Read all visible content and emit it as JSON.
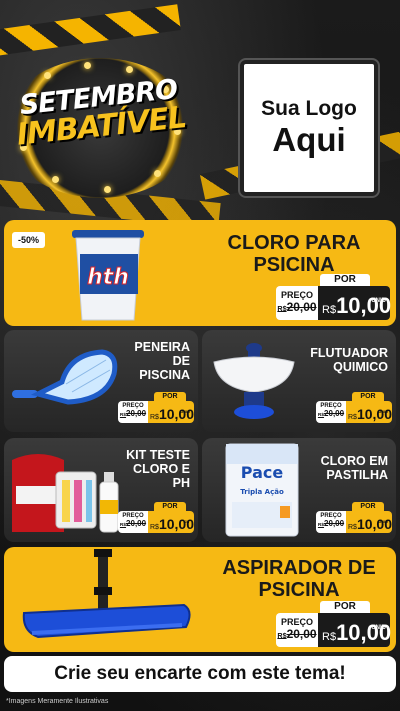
{
  "hero": {
    "badge_line1": "SETEMBRO",
    "badge_line2": "IMBATÍVEL",
    "logo_line1": "Sua Logo",
    "logo_line2": "Aqui"
  },
  "products": [
    {
      "name_line1": "CLORO PARA",
      "name_line2": "PSICINA",
      "discount": "-50%",
      "price_label": "PREÇO",
      "old_currency": "R$",
      "old_price": "20,00",
      "por": "POR",
      "currency": "R$",
      "price": "10,00",
      "unit": "UNID",
      "image_brand": "hth"
    },
    {
      "name_line1": "PENEIRA",
      "name_line2": "DE",
      "name_line3": "PISCINA",
      "price_label": "PREÇO",
      "old_currency": "R$",
      "old_price": "20,00",
      "por": "POR",
      "currency": "R$",
      "price": "10,00",
      "unit": "UNID"
    },
    {
      "name_line1": "FLUTUADOR",
      "name_line2": "QUIMICO",
      "price_label": "PREÇO",
      "old_currency": "R$",
      "old_price": "20,00",
      "por": "POR",
      "currency": "R$",
      "price": "10,00",
      "unit": "UNID"
    },
    {
      "name_line1": "KIT TESTE",
      "name_line2": "CLORO E",
      "name_line3": "PH",
      "price_label": "PREÇO",
      "old_currency": "R$",
      "old_price": "20,00",
      "por": "POR",
      "currency": "R$",
      "price": "10,00",
      "unit": "KIT"
    },
    {
      "name_line1": "CLORO EM",
      "name_line2": "PASTILHA",
      "price_label": "PREÇO",
      "old_currency": "R$",
      "old_price": "20,00",
      "por": "POR",
      "currency": "R$",
      "price": "10,00",
      "unit": "UNID",
      "image_brand": "Pace",
      "image_sub": "Tripla Ação"
    },
    {
      "name_line1": "ASPIRADOR DE",
      "name_line2": "PSICINA",
      "price_label": "PREÇO",
      "old_currency": "R$",
      "old_price": "20,00",
      "por": "POR",
      "currency": "R$",
      "price": "10,00",
      "unit": "UNID"
    }
  ],
  "footer": {
    "cta": "Crie seu encarte com este tema!",
    "note": "*Imagens Meramente Ilustrativas"
  },
  "colors": {
    "accent": "#f6b914",
    "dark": "#1a1a1a",
    "card": "#333333"
  },
  "icons": {
    "bucket": "chlorine-bucket-icon",
    "net": "pool-net-icon",
    "floater": "chemical-floater-icon",
    "kit": "test-kit-icon",
    "bag": "tablet-bag-icon",
    "vacuum": "pool-vacuum-icon"
  }
}
